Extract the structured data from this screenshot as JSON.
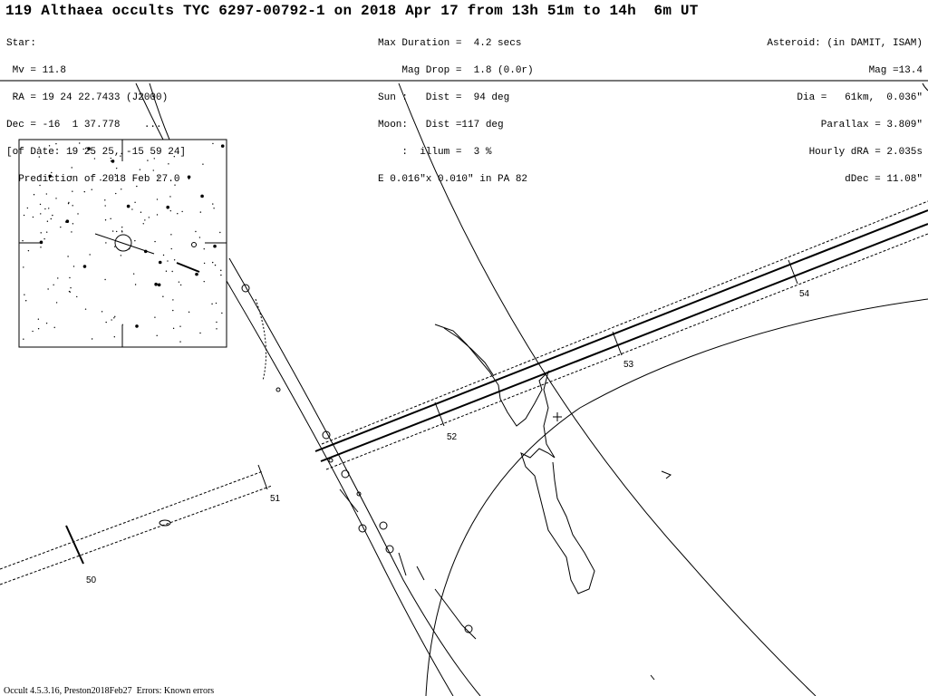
{
  "header": {
    "title": "119 Althaea occults TYC 6297-00792-1 on 2018 Apr 17 from 13h 51m to 14h  6m UT",
    "star": [
      "Star:",
      " Mv = 11.8",
      " RA = 19 24 22.7433 (J2000)",
      "Dec = -16  1 37.778    ...",
      "[of Date: 19 25 25, -15 59 24]",
      "  Prediction of 2018 Feb 27.0"
    ],
    "event": [
      "Max Duration =  4.2 secs",
      "    Mag Drop =  1.8 (0.0r)",
      "Sun :   Dist =  94 deg",
      "Moon:   Dist =117 deg",
      "    :  illum =  3 %",
      "E 0.016\"x 0.010\" in PA 82"
    ],
    "asteroid": [
      "Asteroid: (in DAMIT, ISAM)",
      "Mag =13.4",
      "Dia =   61km,  0.036\"",
      "Parallax = 3.809\"",
      "Hourly dRA = 2.035s",
      "dDec = 11.08\""
    ]
  },
  "map": {
    "time_ticks": [
      "50",
      "51",
      "52",
      "53",
      "54"
    ]
  },
  "footer": "Occult 4.5.3.16, Preston2018Feb27  Errors: Known errors"
}
